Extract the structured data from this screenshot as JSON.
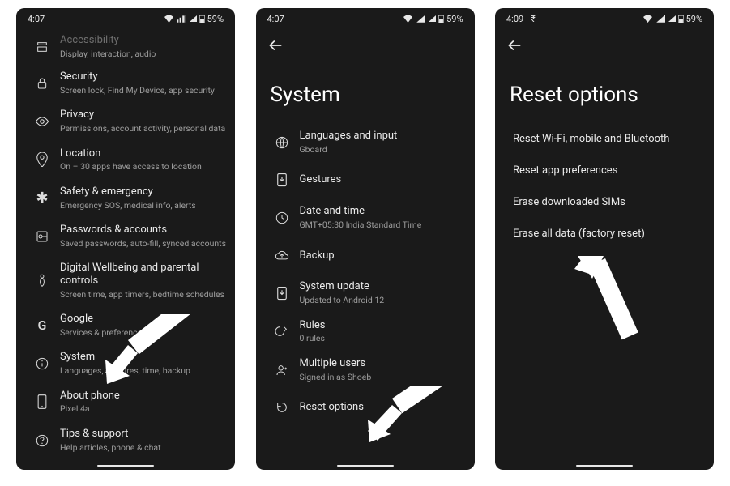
{
  "phone1": {
    "time": "4:07",
    "battery": "59%",
    "items": [
      {
        "title": "Accessibility",
        "sub": "Display, interaction, audio"
      },
      {
        "title": "Security",
        "sub": "Screen lock, Find My Device, app security"
      },
      {
        "title": "Privacy",
        "sub": "Permissions, account activity, personal data"
      },
      {
        "title": "Location",
        "sub": "On – 30 apps have access to location"
      },
      {
        "title": "Safety & emergency",
        "sub": "Emergency SOS, medical info, alerts"
      },
      {
        "title": "Passwords & accounts",
        "sub": "Saved passwords, auto-fill, synced accounts"
      },
      {
        "title": "Digital Wellbeing and parental controls",
        "sub": "Screen time, app timers, bedtime schedules"
      },
      {
        "title": "Google",
        "sub": "Services & preferences"
      },
      {
        "title": "System",
        "sub": "Languages, gestures, time, backup"
      },
      {
        "title": "About phone",
        "sub": "Pixel 4a"
      },
      {
        "title": "Tips & support",
        "sub": "Help articles, phone & chat"
      }
    ]
  },
  "phone2": {
    "time": "4:07",
    "battery": "59%",
    "title": "System",
    "items": [
      {
        "title": "Languages and input",
        "sub": "Gboard"
      },
      {
        "title": "Gestures",
        "sub": ""
      },
      {
        "title": "Date and time",
        "sub": "GMT+05:30 India Standard Time"
      },
      {
        "title": "Backup",
        "sub": ""
      },
      {
        "title": "System update",
        "sub": "Updated to Android 12"
      },
      {
        "title": "Rules",
        "sub": "0 rules"
      },
      {
        "title": "Multiple users",
        "sub": "Signed in as Shoeb"
      },
      {
        "title": "Reset options",
        "sub": ""
      }
    ]
  },
  "phone3": {
    "time": "4:09",
    "battery": "59%",
    "extra_status": "₹",
    "title": "Reset options",
    "items": [
      {
        "title": "Reset Wi-Fi, mobile and Bluetooth"
      },
      {
        "title": "Reset app preferences"
      },
      {
        "title": "Erase downloaded SIMs"
      },
      {
        "title": "Erase all data (factory reset)"
      }
    ]
  }
}
